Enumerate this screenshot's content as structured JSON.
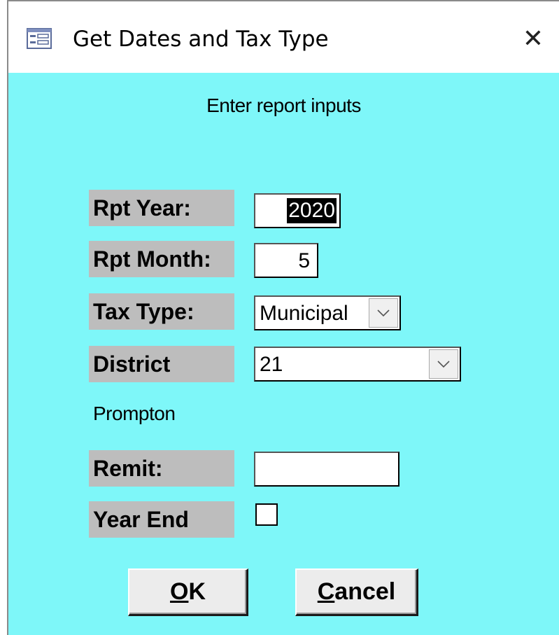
{
  "window": {
    "title": "Get Dates and Tax Type",
    "icon": "form-icon",
    "close_glyph": "✕"
  },
  "form": {
    "header": "Enter report inputs",
    "rpt_year": {
      "label": "Rpt Year:",
      "value": "2020"
    },
    "rpt_month": {
      "label": "Rpt Month:",
      "value": "5"
    },
    "tax_type": {
      "label": "Tax Type:",
      "value": "Municipal"
    },
    "district": {
      "label": "District",
      "value": "21",
      "name": "Prompton"
    },
    "remit": {
      "label": "Remit:",
      "value": ""
    },
    "year_end": {
      "label": "Year End",
      "checked": false
    }
  },
  "buttons": {
    "ok": {
      "mnemonic": "O",
      "rest": "K"
    },
    "cancel": {
      "mnemonic": "C",
      "rest": "ancel"
    }
  },
  "colors": {
    "background": "#7ef7f9",
    "label_bg": "#bdbdbd",
    "button_bg": "#ececec"
  }
}
